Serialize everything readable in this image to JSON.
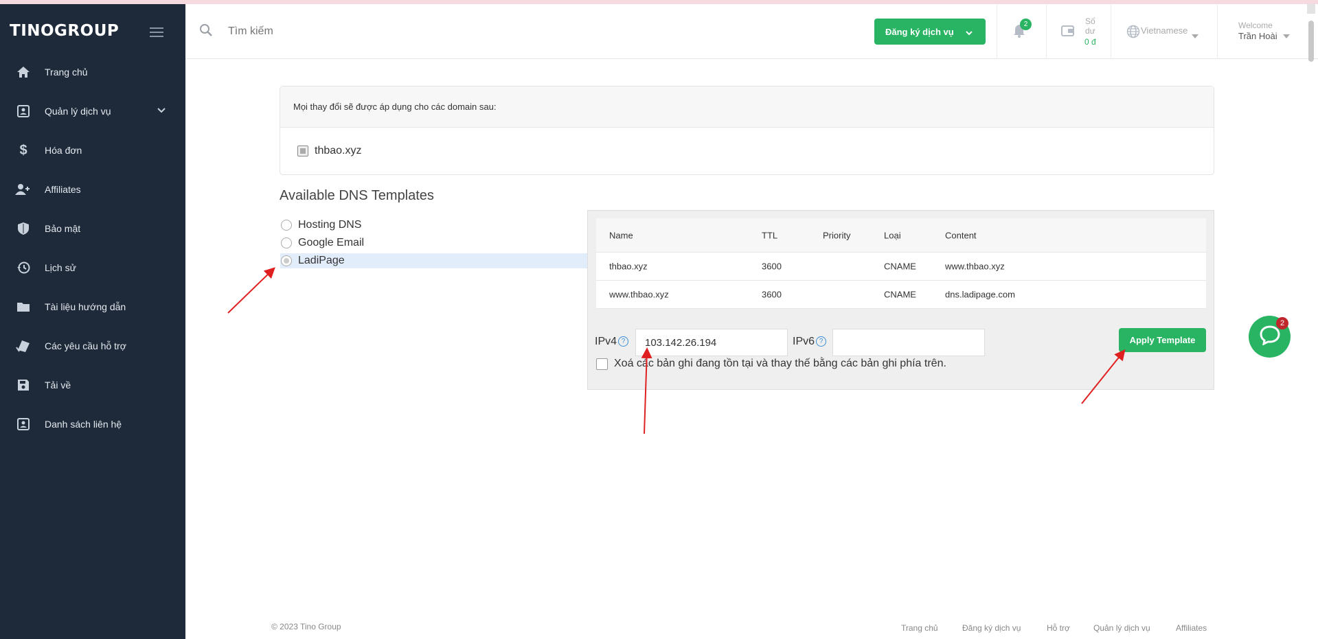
{
  "brand": {
    "logo": "TINOGROUP"
  },
  "sidebar": {
    "items": [
      {
        "label": "Trang chủ",
        "icon": "home-icon"
      },
      {
        "label": "Quản lý dịch vụ",
        "icon": "id-card-icon"
      },
      {
        "label": "Hóa đơn",
        "icon": "dollar-icon"
      },
      {
        "label": "Affiliates",
        "icon": "users-icon"
      },
      {
        "label": "Bảo mật",
        "icon": "shield-icon"
      },
      {
        "label": "Lịch sử",
        "icon": "history-icon"
      },
      {
        "label": "Tài liệu hướng dẫn",
        "icon": "folder-icon"
      },
      {
        "label": "Các yêu cầu hỗ trợ",
        "icon": "ticket-icon"
      },
      {
        "label": "Tải về",
        "icon": "save-icon"
      },
      {
        "label": "Danh sách liên hệ",
        "icon": "contact-icon"
      }
    ]
  },
  "header": {
    "search_placeholder": "Tìm kiếm",
    "register_button": "Đăng ký dịch vụ",
    "notification_count": "2",
    "balance_label": "Số dư",
    "balance_value": "0 đ",
    "language": "Vietnamese",
    "welcome": "Welcome",
    "user_name": "Trần Hoài"
  },
  "domains": {
    "heading": "Mọi thay đổi sẽ được áp dụng cho các domain sau:",
    "items": [
      "thbao.xyz"
    ]
  },
  "templates": {
    "title": "Available DNS Templates",
    "options": [
      "Hosting DNS",
      "Google Email",
      "LadiPage"
    ],
    "selected": "LadiPage"
  },
  "dns_table": {
    "columns": [
      "Name",
      "TTL",
      "Priority",
      "Loại",
      "Content"
    ],
    "rows": [
      [
        "thbao.xyz",
        "3600",
        "",
        "CNAME",
        "www.thbao.xyz"
      ],
      [
        "www.thbao.xyz",
        "3600",
        "",
        "CNAME",
        "dns.ladipage.com"
      ]
    ]
  },
  "form": {
    "ipv4_label": "IPv4",
    "ipv4_value": "103.142.26.194",
    "ipv6_label": "IPv6",
    "ipv6_value": "",
    "help_glyph": "?",
    "replace_label": "Xoá các bản ghi đang tồn tại và thay thế bằng các bản ghi phía trên.",
    "apply_button": "Apply Template"
  },
  "chat": {
    "badge": "2"
  },
  "footer": {
    "copyright": "© 2023 Tino Group",
    "links": [
      "Trang chủ",
      "Đăng ký dịch vụ",
      "Hỗ trợ",
      "Quản lý dịch vụ",
      "Affiliates"
    ]
  },
  "colors": {
    "sidebar": "#1e2a3a",
    "accent": "#28b463",
    "annotation_arrow": "#e02020"
  }
}
